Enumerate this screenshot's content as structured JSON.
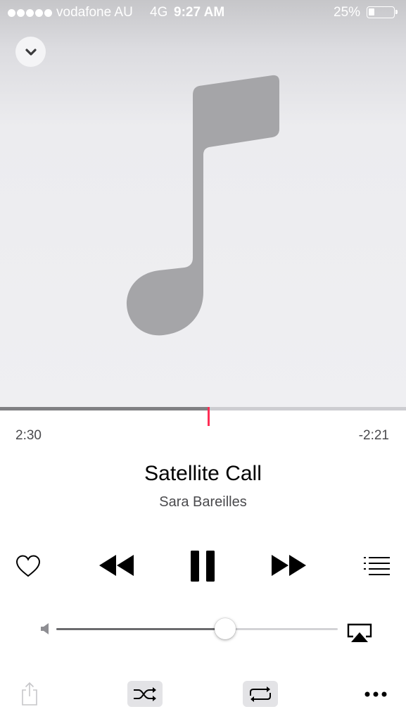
{
  "status_bar": {
    "signal_bars": 5,
    "carrier": "vodafone AU",
    "network": "4G",
    "time": "9:27 AM",
    "battery_percent": "25%",
    "battery_level": 0.25
  },
  "player": {
    "collapse_icon": "chevron-down-icon",
    "artwork_icon": "music-note-icon",
    "elapsed": "2:30",
    "remaining": "-2:21",
    "progress_fraction": 0.513,
    "title": "Satellite Call",
    "artist": "Sara Bareilles"
  },
  "controls": {
    "love_icon": "heart-icon",
    "previous_icon": "rewind-icon",
    "play_pause_icon": "pause-icon",
    "next_icon": "fast-forward-icon",
    "up_next_icon": "list-icon"
  },
  "volume": {
    "level": 0.6,
    "speaker_icon": "speaker-icon",
    "airplay_icon": "airplay-icon"
  },
  "bottom_bar": {
    "share_icon": "share-icon",
    "shuffle_icon": "shuffle-icon",
    "repeat_icon": "repeat-icon",
    "more_icon": "more-icon"
  },
  "colors": {
    "accent": "#ff2d55",
    "artwork_bg": "#efeff2",
    "note": "#a5a5a8"
  }
}
